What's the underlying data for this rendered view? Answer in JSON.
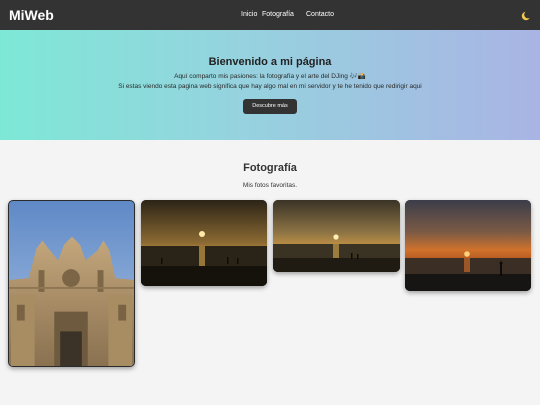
{
  "header": {
    "brand": "MiWeb",
    "nav": [
      "Inicio",
      "Fotografía",
      "Contacto"
    ],
    "theme_toggle_icon": "moon-icon"
  },
  "hero": {
    "title": "Bienvenido a mi página",
    "line1": "Aquí comparto mis pasiones: la fotografía y el arte del DJing 🎶📸",
    "line2": "Si estas viendo esta pagina web significa que hay algo mal en mi servidor y te he tenido que redirigir aqui",
    "button_label": "Descubre más"
  },
  "gallery": {
    "title": "Fotografía",
    "subtitle": "Mis fotos favoritas.",
    "photos": [
      "cathedral-facade-photo",
      "beach-sunset-photo",
      "sea-sunset-photo",
      "orange-sunset-photo"
    ]
  },
  "colors": {
    "navbar": "#333333",
    "hero_gradient_start": "#7ee8d6",
    "hero_gradient_end": "#a9b4e4",
    "button": "#333333",
    "page_background": "#f4f4f4"
  }
}
